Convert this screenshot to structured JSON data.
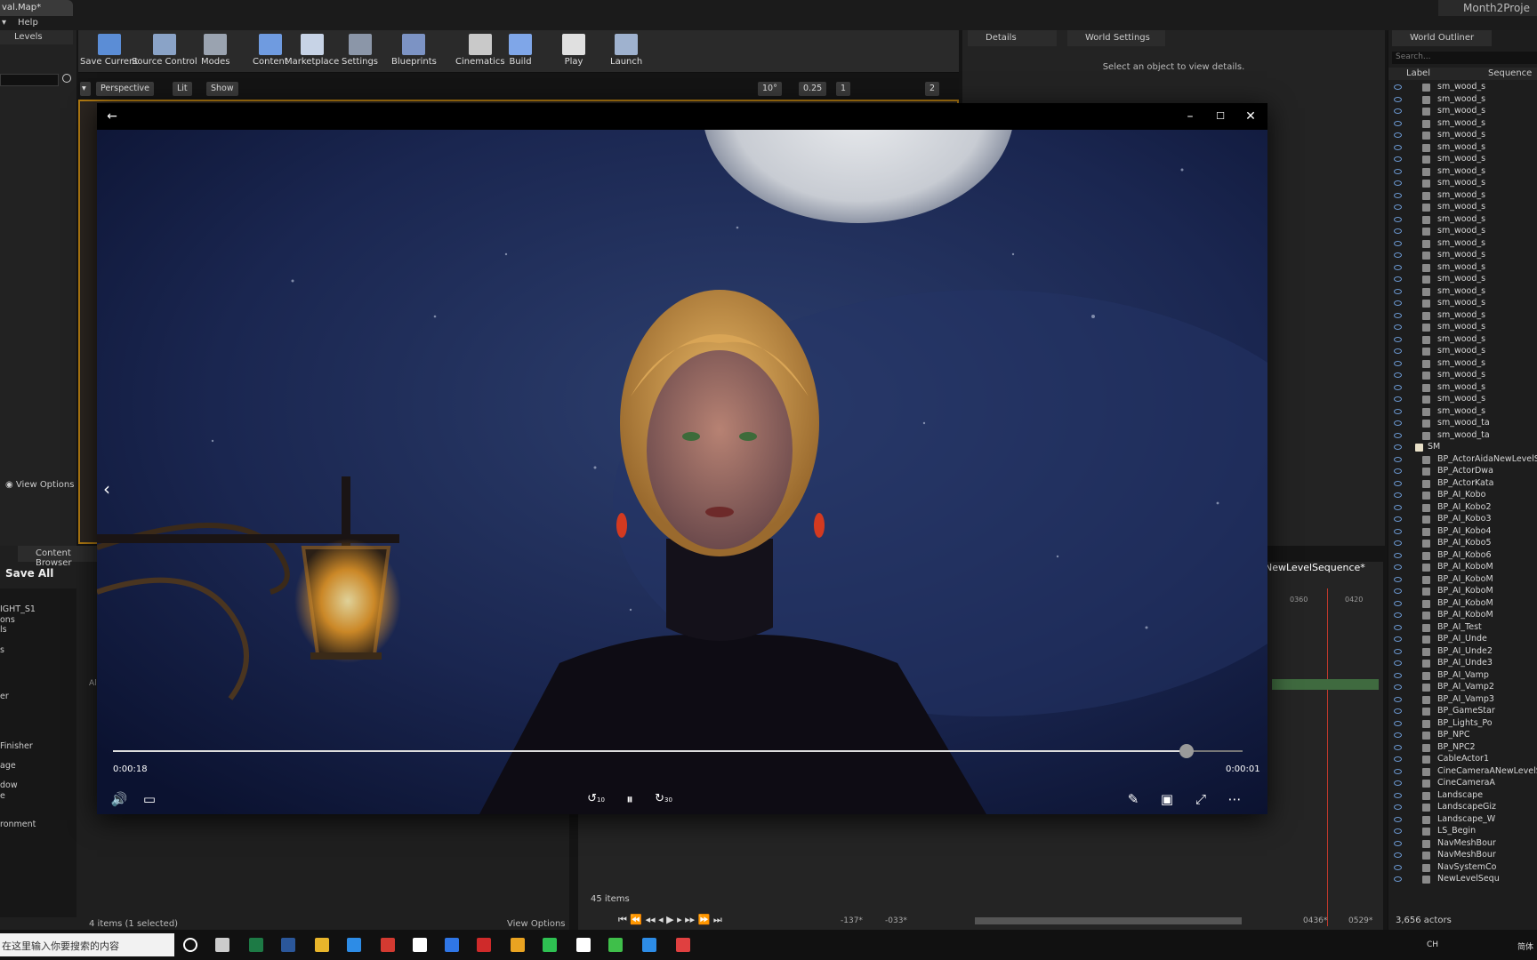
{
  "editor": {
    "doc_tab": "val.Map*",
    "project_name": "Month2Proje",
    "menu": {
      "item_help": "Help"
    },
    "levels_tab": "Levels",
    "levels_view_options": "View Options",
    "toolbar": [
      {
        "label": "Save Current",
        "icon": "save-icon",
        "color": "#5b8dd6"
      },
      {
        "label": "Source Control",
        "icon": "source-control-icon",
        "color": "#8aa3c7"
      },
      {
        "label": "Modes",
        "icon": "modes-icon",
        "color": "#9aa3b0"
      },
      {
        "label": "Content",
        "icon": "content-icon",
        "color": "#6f9be0"
      },
      {
        "label": "Marketplace",
        "icon": "marketplace-icon",
        "color": "#c7d3e6"
      },
      {
        "label": "Settings",
        "icon": "settings-icon",
        "color": "#8b96a8"
      },
      {
        "label": "Blueprints",
        "icon": "blueprints-icon",
        "color": "#7c93c4"
      },
      {
        "label": "Cinematics",
        "icon": "cinematics-icon",
        "color": "#c9c9c9"
      },
      {
        "label": "Build",
        "icon": "build-icon",
        "color": "#7fa6e8"
      },
      {
        "label": "Play",
        "icon": "play-icon",
        "color": "#e0e0e0"
      },
      {
        "label": "Launch",
        "icon": "launch-icon",
        "color": "#9fb2cf"
      }
    ],
    "viewport": {
      "perspective": "Perspective",
      "lit": "Lit",
      "show": "Show",
      "angle": "10°",
      "scale": "0.25",
      "grid": "1",
      "camera_speed": "2"
    },
    "details": {
      "tab_details": "Details",
      "tab_world_settings": "World Settings",
      "hint": "Select an object to view details."
    },
    "outliner": {
      "title": "World Outliner",
      "search_placeholder": "Search...",
      "col_label": "Label",
      "col_sequence": "Sequence",
      "items": [
        "sm_wood_s",
        "sm_wood_s",
        "sm_wood_s",
        "sm_wood_s",
        "sm_wood_s",
        "sm_wood_s",
        "sm_wood_s",
        "sm_wood_s",
        "sm_wood_s",
        "sm_wood_s",
        "sm_wood_s",
        "sm_wood_s",
        "sm_wood_s",
        "sm_wood_s",
        "sm_wood_s",
        "sm_wood_s",
        "sm_wood_s",
        "sm_wood_s",
        "sm_wood_s",
        "sm_wood_s",
        "sm_wood_s",
        "sm_wood_s",
        "sm_wood_s",
        "sm_wood_s",
        "sm_wood_s",
        "sm_wood_s",
        "sm_wood_s",
        "sm_wood_s",
        "sm_wood_ta",
        "sm_wood_ta",
        "SM",
        "BP_ActorAidaNewLevelSequ",
        "BP_ActorDwa",
        "BP_ActorKata",
        "BP_AI_Kobo",
        "BP_AI_Kobo2",
        "BP_AI_Kobo3",
        "BP_AI_Kobo4",
        "BP_AI_Kobo5",
        "BP_AI_Kobo6",
        "BP_AI_KoboM",
        "BP_AI_KoboM",
        "BP_AI_KoboM",
        "BP_AI_KoboM",
        "BP_AI_KoboM",
        "BP_AI_Test",
        "BP_AI_Unde",
        "BP_AI_Unde2",
        "BP_AI_Unde3",
        "BP_AI_Vamp",
        "BP_AI_Vamp2",
        "BP_AI_Vamp3",
        "BP_GameStar",
        "BP_Lights_Po",
        "BP_NPC",
        "BP_NPC2",
        "CableActor1",
        "CineCameraANewLevelSequ",
        "CineCameraA",
        "Landscape",
        "LandscapeGiz",
        "Landscape_W",
        "LS_Begin",
        "NavMeshBour",
        "NavMeshBour",
        "NavSystemCo",
        "NewLevelSequ"
      ],
      "actor_count": "3,656 actors"
    },
    "content_browser": {
      "tab": "Content Browser",
      "save_all": "Save All",
      "tree": [
        "IGHT_S1",
        "ons",
        "ls",
        "s",
        "er",
        "Finisher",
        "age",
        "dow",
        "e",
        "ronment"
      ],
      "all_label": "All",
      "status": "4 items (1 selected)",
      "view_options": "View Options"
    },
    "sequencer": {
      "title": "NewLevelSequence*",
      "items": "45 items",
      "frame_start": "-137*",
      "frame_in": "-033*",
      "frame_out": "0436*",
      "frame_end": "0529*",
      "tick_a": "0360",
      "tick_b": "0420"
    }
  },
  "player": {
    "time_elapsed": "0:00:18",
    "time_remaining": "0:00:01",
    "progress": 0.95,
    "skip_back_label": "10",
    "skip_forward_label": "30"
  },
  "taskbar": {
    "search_placeholder": "在这里输入你要搜索的内容",
    "lang": "CH",
    "ime": "简体"
  }
}
